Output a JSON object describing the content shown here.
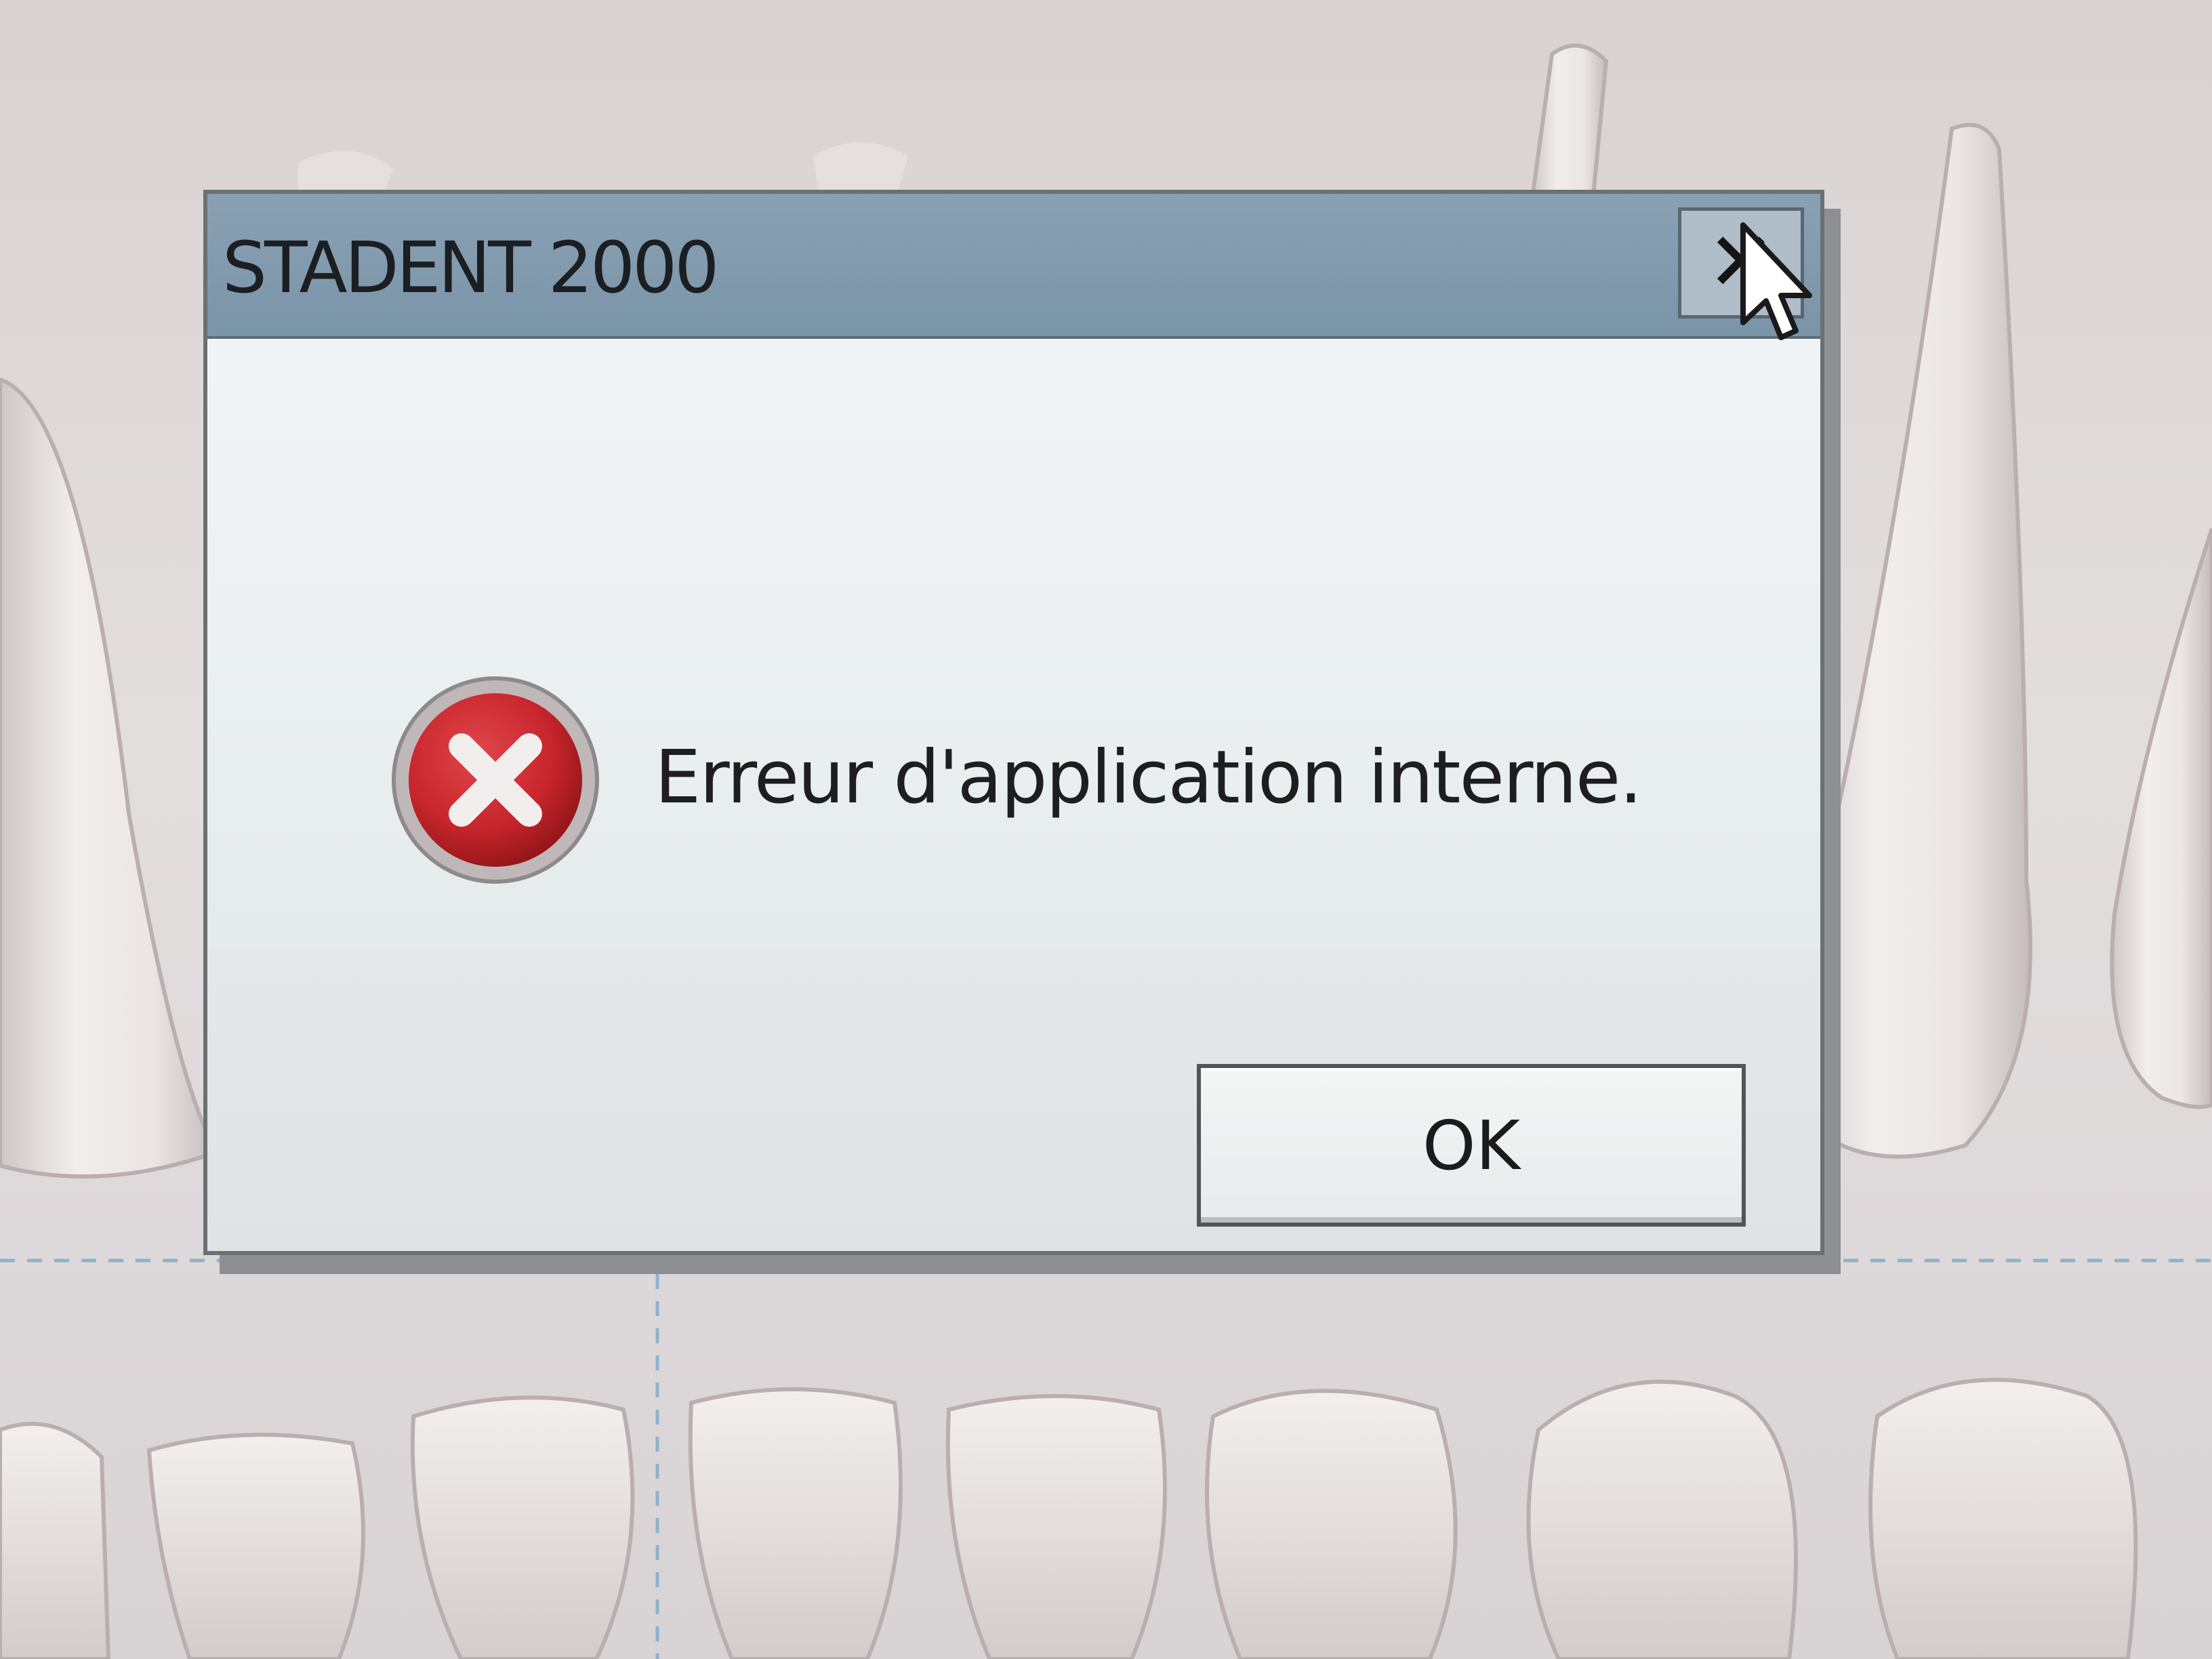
{
  "dialog": {
    "title": "STADENT 2000",
    "close_icon": "close-icon",
    "message": "Erreur d'application interne.",
    "message_icon": "error-icon",
    "ok_label": "OK"
  },
  "colors": {
    "title_bar": "#7a94a8",
    "error_red": "#c8262c",
    "dialog_bg": "#eceff0"
  }
}
